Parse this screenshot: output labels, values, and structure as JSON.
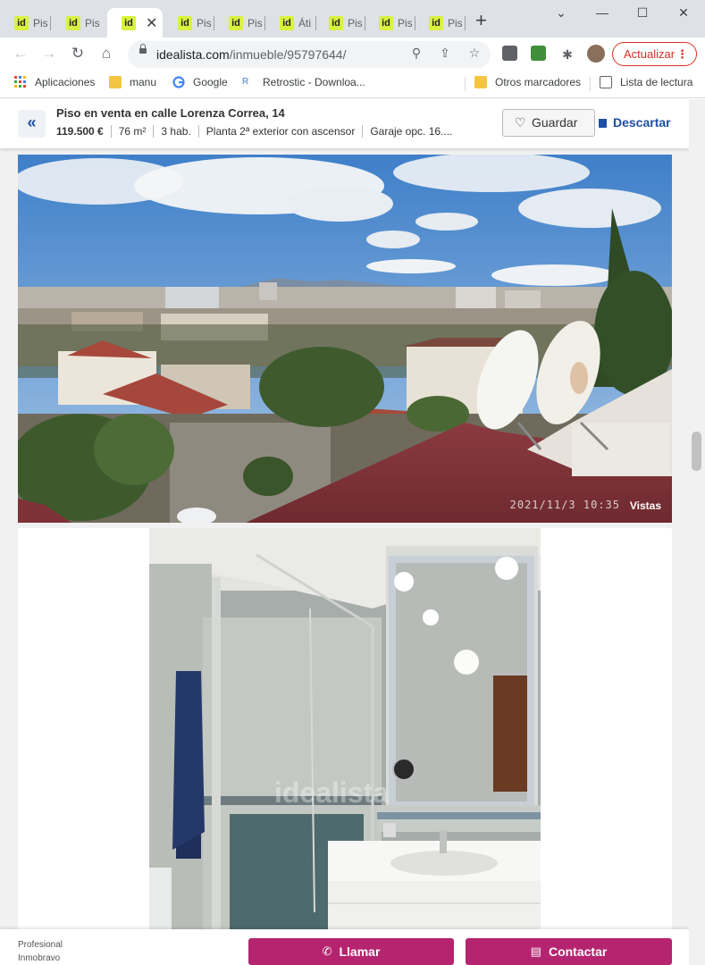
{
  "browser": {
    "tabs": [
      {
        "label": "Pis",
        "favicon": "id"
      },
      {
        "label": "Pis",
        "favicon": "id"
      },
      {
        "label": "",
        "favicon": "id",
        "active": true
      },
      {
        "label": "Pis",
        "favicon": "id"
      },
      {
        "label": "Pis",
        "favicon": "id"
      },
      {
        "label": "Áti",
        "favicon": "id"
      },
      {
        "label": "Pis",
        "favicon": "id"
      },
      {
        "label": "Pis",
        "favicon": "id"
      },
      {
        "label": "Pis",
        "favicon": "id"
      }
    ],
    "close_glyph": "✕",
    "new_tab_glyph": "+",
    "url_host": "idealista.com",
    "url_path": "/inmueble/95797644/",
    "update_button": "Actualizar",
    "update_dots": "⋮",
    "accent_color": "#d93025"
  },
  "bookmarks": [
    {
      "label": "Aplicaciones",
      "icon": "apps-grid-icon"
    },
    {
      "label": "manu",
      "icon": "folder-icon"
    },
    {
      "label": "Google",
      "icon": "google-icon"
    },
    {
      "label": "Retrostic - Downloa...",
      "icon": "retrostic-icon"
    },
    {
      "label": "Otros marcadores",
      "icon": "folder-icon"
    },
    {
      "label": "Lista de lectura",
      "icon": "reading-list-icon"
    }
  ],
  "listing": {
    "title": "Piso en venta en calle Lorenza Correa, 14",
    "price": "119.500 €",
    "area": "76 m²",
    "rooms": "3 hab.",
    "floor": "Planta 2ª exterior con ascensor",
    "garage": "Garaje opc. 16....",
    "save_button": "Guardar",
    "discard_button": "Descartar",
    "back_glyph": "«",
    "brand_color": "#1e4fa3"
  },
  "photos": {
    "photo1_timestamp": "2021/11/3 10:35",
    "photo1_label": "Vistas",
    "photo2_watermark": "idealista"
  },
  "footer": {
    "agent_type": "Profesional",
    "agent_name": "Inmobravo",
    "call_button": "Llamar",
    "contact_button": "Contactar",
    "cta_color": "#b5246f"
  }
}
